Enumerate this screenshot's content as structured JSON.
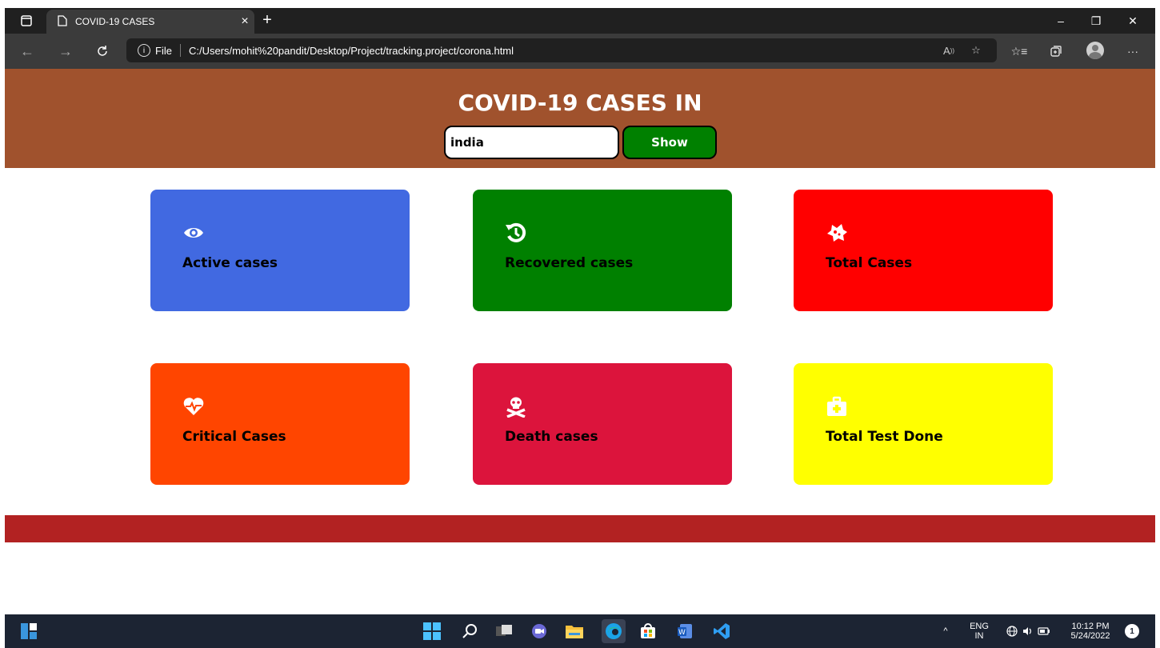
{
  "browser": {
    "tab_title": "COVID-19 CASES",
    "tab_close": "×",
    "new_tab": "+",
    "address_info": "i",
    "address_file_label": "File",
    "address_url": "C:/Users/mohit%20pandit/Desktop/Project/tracking.project/corona.html",
    "window_min": "–",
    "window_restore": "❐",
    "window_close": "✕",
    "more": "···"
  },
  "header": {
    "title": "COVID-19 CASES IN",
    "search_value": "india",
    "show_button": "Show"
  },
  "cards": [
    {
      "label": "Active cases",
      "icon": "eye-icon",
      "color": "#4169e1"
    },
    {
      "label": "Recovered cases",
      "icon": "history-icon",
      "color": "#008000"
    },
    {
      "label": "Total Cases",
      "icon": "virus-icon",
      "color": "#ff0000"
    },
    {
      "label": "Critical Cases",
      "icon": "heartbeat-icon",
      "color": "#ff4500"
    },
    {
      "label": "Death cases",
      "icon": "skull-crossbones-icon",
      "color": "#dc143c"
    },
    {
      "label": "Total Test Done",
      "icon": "medkit-icon",
      "color": "#ffff00"
    }
  ],
  "colors": {
    "header_bg": "#a0522d",
    "footer_bg": "#b22222",
    "show_button_bg": "#008000"
  },
  "taskbar": {
    "lang_top": "ENG",
    "lang_bottom": "IN",
    "time": "10:12 PM",
    "date": "5/24/2022",
    "notification_count": "1"
  }
}
